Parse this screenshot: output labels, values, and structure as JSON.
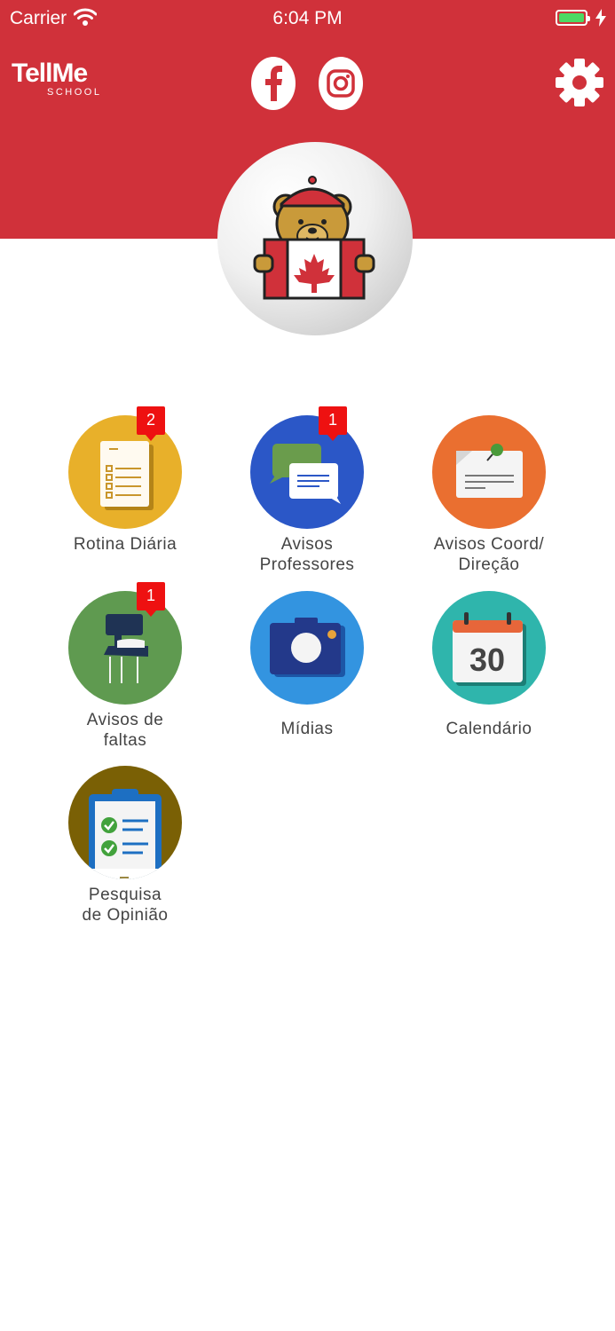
{
  "status_bar": {
    "carrier": "Carrier",
    "time": "6:04 PM"
  },
  "header": {
    "logo_text": "TellMe",
    "logo_sub": "SCHOOL",
    "background_color": "#d0313a",
    "icons": [
      "facebook-icon",
      "instagram-icon",
      "settings-icon"
    ]
  },
  "menu": [
    {
      "label": "Rotina Diária",
      "badge": "2",
      "color": "#e8b02a",
      "icon": "daily-routine-icon"
    },
    {
      "label": "Avisos Professores",
      "badge": "1",
      "color": "#2b57c7",
      "icon": "chat-icon"
    },
    {
      "label": "Avisos Coord/ Direção",
      "badge": "",
      "color": "#ea6f30",
      "icon": "pinned-note-icon"
    },
    {
      "label": "Avisos de faltas",
      "badge": "1",
      "color": "#5f9a50",
      "icon": "school-desk-icon"
    },
    {
      "label": "Mídias",
      "badge": "",
      "color": "#3394e0",
      "icon": "camera-icon"
    },
    {
      "label": "Calendário",
      "badge": "",
      "color": "#2fb5ac",
      "icon": "calendar-icon",
      "calendar_day": "30"
    },
    {
      "label": "Pesquisa de Opinião",
      "badge": "",
      "color": "#7a6005",
      "icon": "clipboard-checklist-icon"
    }
  ]
}
